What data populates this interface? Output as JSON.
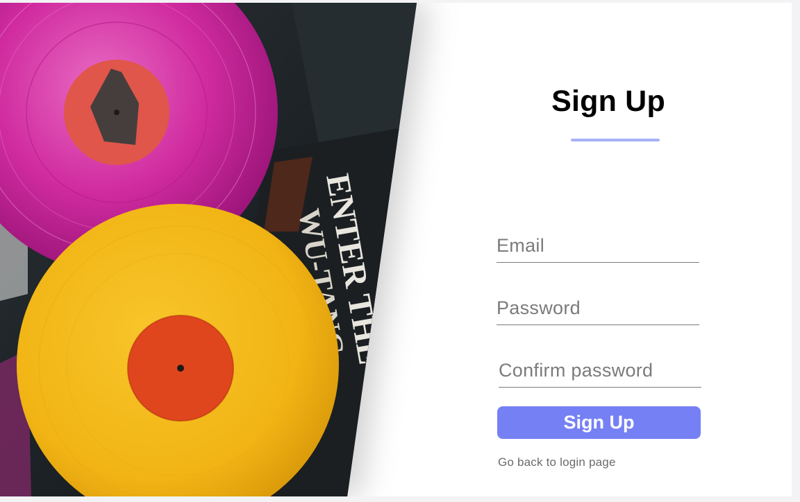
{
  "signup": {
    "title": "Sign Up",
    "email_placeholder": "Email",
    "password_placeholder": "Password",
    "confirm_placeholder": "Confirm password",
    "submit_label": "Sign Up",
    "back_link": "Go back to login page"
  },
  "colors": {
    "accent": "#7680f5",
    "underline": "#a6b0f7",
    "pink_record": "#d12aa0",
    "yellow_record": "#f3b713",
    "label_red": "#e0461e"
  }
}
